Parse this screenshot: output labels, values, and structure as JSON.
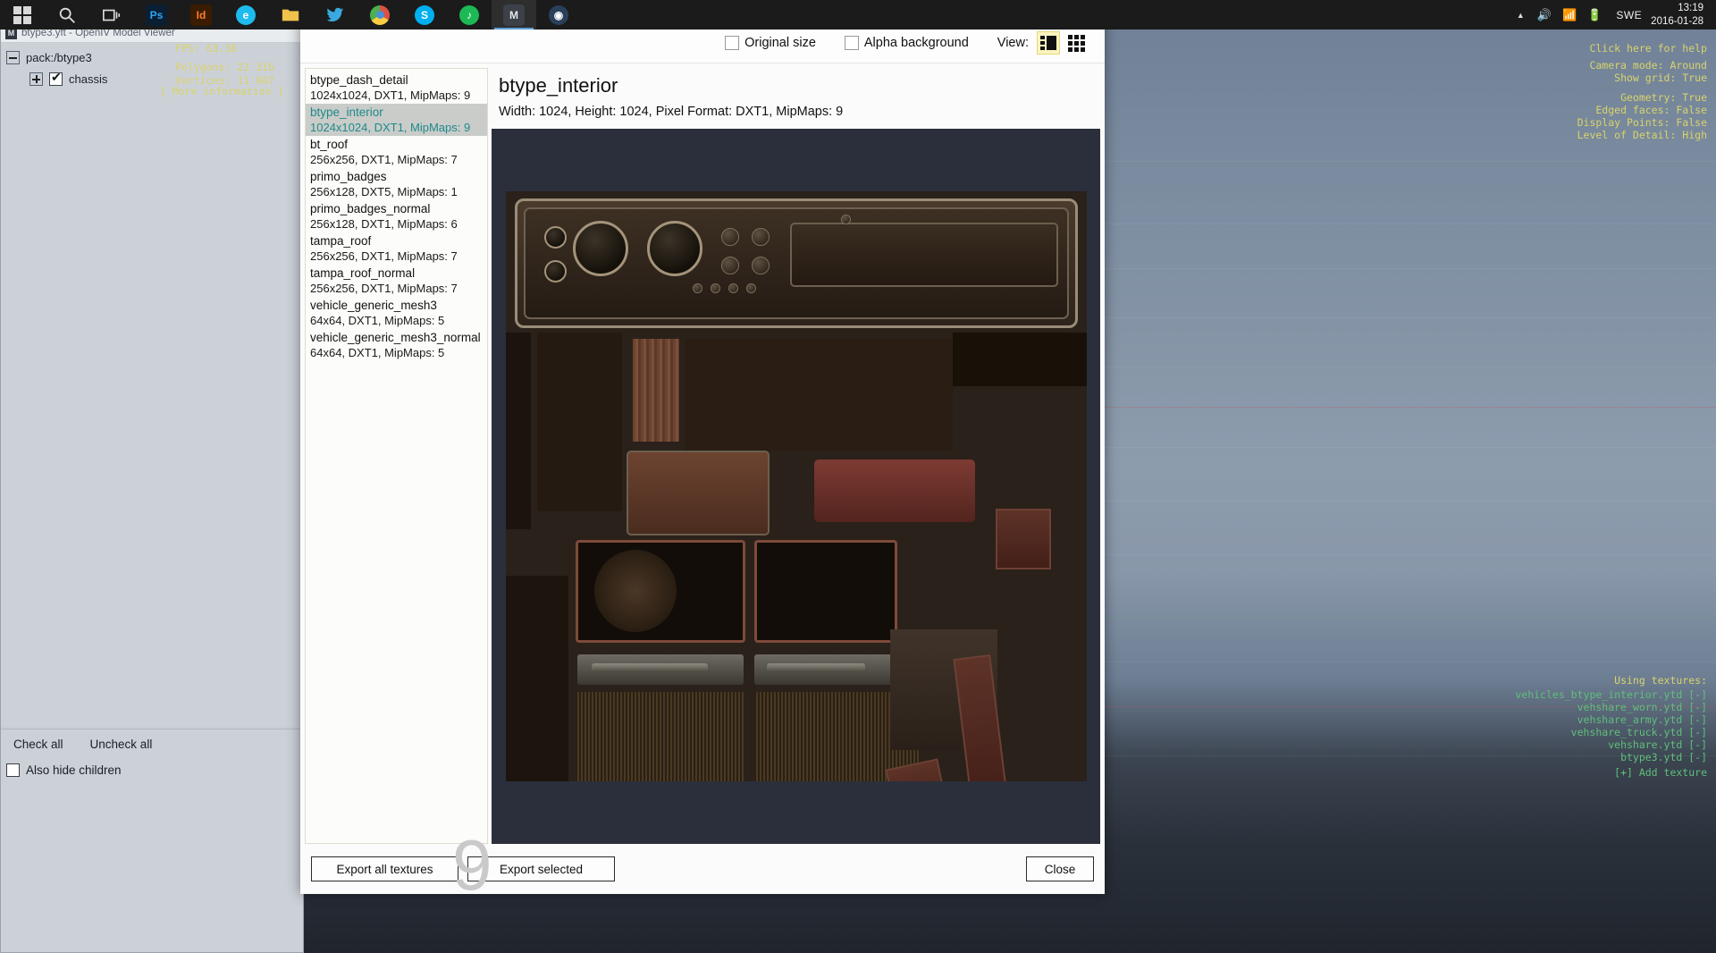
{
  "taskbar": {
    "apps": [
      {
        "name": "windows-start",
        "icon": "windows-logo-icon",
        "label": ""
      },
      {
        "name": "search",
        "icon": "search-icon",
        "label": ""
      },
      {
        "name": "task-view",
        "icon": "task-view-icon",
        "label": ""
      },
      {
        "name": "photoshop",
        "icon": "photoshop-icon",
        "label": "Ps"
      },
      {
        "name": "indesign",
        "icon": "indesign-icon",
        "label": "Id"
      },
      {
        "name": "edge",
        "icon": "edge-icon",
        "label": "e"
      },
      {
        "name": "file-explorer",
        "icon": "folder-icon",
        "label": ""
      },
      {
        "name": "twitter",
        "icon": "bird-icon",
        "label": ""
      },
      {
        "name": "chrome",
        "icon": "chrome-icon",
        "label": ""
      },
      {
        "name": "skype",
        "icon": "skype-icon",
        "label": "S"
      },
      {
        "name": "spotify",
        "icon": "spotify-icon",
        "label": ""
      },
      {
        "name": "model-viewer",
        "icon": "openiv-icon",
        "label": "M"
      },
      {
        "name": "steam",
        "icon": "steam-icon",
        "label": ""
      }
    ],
    "tray": {
      "chevron": "▲",
      "volume": "🔊",
      "network": "📶",
      "battery": "🔋",
      "language": "SWE",
      "time": "13:19",
      "date": "2016-01-28"
    }
  },
  "model_viewer": {
    "title": "btype3.yft - OpenIV Model Viewer",
    "title_icon": "openiv-window-icon",
    "tree": [
      {
        "label": "pack:/btype3",
        "expander": "minus",
        "checkbox": null
      },
      {
        "label": "chassis",
        "expander": "plus",
        "checkbox": true
      }
    ],
    "check_all": "Check all",
    "uncheck_all": "Uncheck all",
    "also_hide_children": "Also hide children",
    "also_hide_children_checked": false
  },
  "viewport_overlay": {
    "left": [
      "FPS: 63.38",
      "",
      "Polygons: 22 316",
      "Vertices: 11 047",
      "[ More information ]"
    ],
    "right_top": [
      "Click here for help",
      "",
      "Camera mode: Around",
      "Show grid: True",
      "",
      "Geometry: True",
      "Edged faces: False",
      "Display Points: False",
      "Level of Detail: High"
    ],
    "right_bottom_header": "Using textures:",
    "right_bottom": [
      "vehicles_btype_interior.ytd [-]",
      "vehshare_worn.ytd [-]",
      "vehshare_army.ytd [-]",
      "vehshare_truck.ytd [-]",
      "vehshare.ytd [-]",
      "btype3.ytd [-]",
      "[+] Add texture"
    ]
  },
  "dialog": {
    "titlebar": {
      "title": "",
      "minimize": "–",
      "maximize": "❐",
      "close": "✕"
    },
    "toolbar": {
      "original_size_label": "Original size",
      "original_size_checked": false,
      "alpha_background_label": "Alpha background",
      "alpha_background_checked": false,
      "view_label": "View:",
      "view_list_icon": "list-view-icon",
      "view_grid_icon": "grid-view-icon",
      "active_view": "list"
    },
    "textures": [
      {
        "name": "btype_dash_detail",
        "meta": "1024x1024, DXT1, MipMaps: 9",
        "selected": false
      },
      {
        "name": "btype_interior",
        "meta": "1024x1024, DXT1, MipMaps: 9",
        "selected": true
      },
      {
        "name": "bt_roof",
        "meta": "256x256, DXT1, MipMaps: 7",
        "selected": false
      },
      {
        "name": "primo_badges",
        "meta": "256x128, DXT5, MipMaps: 1",
        "selected": false
      },
      {
        "name": "primo_badges_normal",
        "meta": "256x128, DXT1, MipMaps: 6",
        "selected": false
      },
      {
        "name": "tampa_roof",
        "meta": "256x256, DXT1, MipMaps: 7",
        "selected": false
      },
      {
        "name": "tampa_roof_normal",
        "meta": "256x256, DXT1, MipMaps: 7",
        "selected": false
      },
      {
        "name": "vehicle_generic_mesh3",
        "meta": "64x64, DXT1, MipMaps: 5",
        "selected": false
      },
      {
        "name": "vehicle_generic_mesh3_normal",
        "meta": "64x64, DXT1, MipMaps: 5",
        "selected": false
      }
    ],
    "detail": {
      "name": "btype_interior",
      "meta": "Width: 1024, Height: 1024, Pixel Format: DXT1, MipMaps: 9",
      "mip_watermark": "9"
    },
    "footer": {
      "export_all": "Export all textures",
      "export_selected": "Export selected",
      "close": "Close"
    }
  },
  "colors": {
    "accent": "#1f8a8a",
    "selection_bg": "#c9ccc9",
    "view_active": "#fdf3c0",
    "overlay_yellow": "#d9d36a",
    "overlay_green": "#5fbf7a",
    "taskbar_bg": "#1b1b1b"
  }
}
